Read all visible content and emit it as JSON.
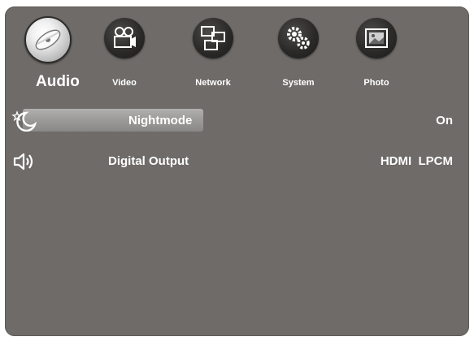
{
  "menu": {
    "tabs": [
      {
        "label": "Audio",
        "icon": "disc-icon",
        "active": true
      },
      {
        "label": "Video",
        "icon": "projector-icon",
        "active": false
      },
      {
        "label": "Network",
        "icon": "network-icon",
        "active": false
      },
      {
        "label": "System",
        "icon": "gears-icon",
        "active": false
      },
      {
        "label": "Photo",
        "icon": "photo-icon",
        "active": false
      }
    ]
  },
  "settings": [
    {
      "label": "Nightmode",
      "value": "On",
      "icon": "moon-icon",
      "selected": true
    },
    {
      "label": "Digital Output",
      "value": "HDMI  LPCM",
      "icon": "speaker-icon",
      "selected": false
    }
  ],
  "colors": {
    "background": "#6e6b69",
    "highlight": "#a6a4a2",
    "text": "#ffffff"
  }
}
